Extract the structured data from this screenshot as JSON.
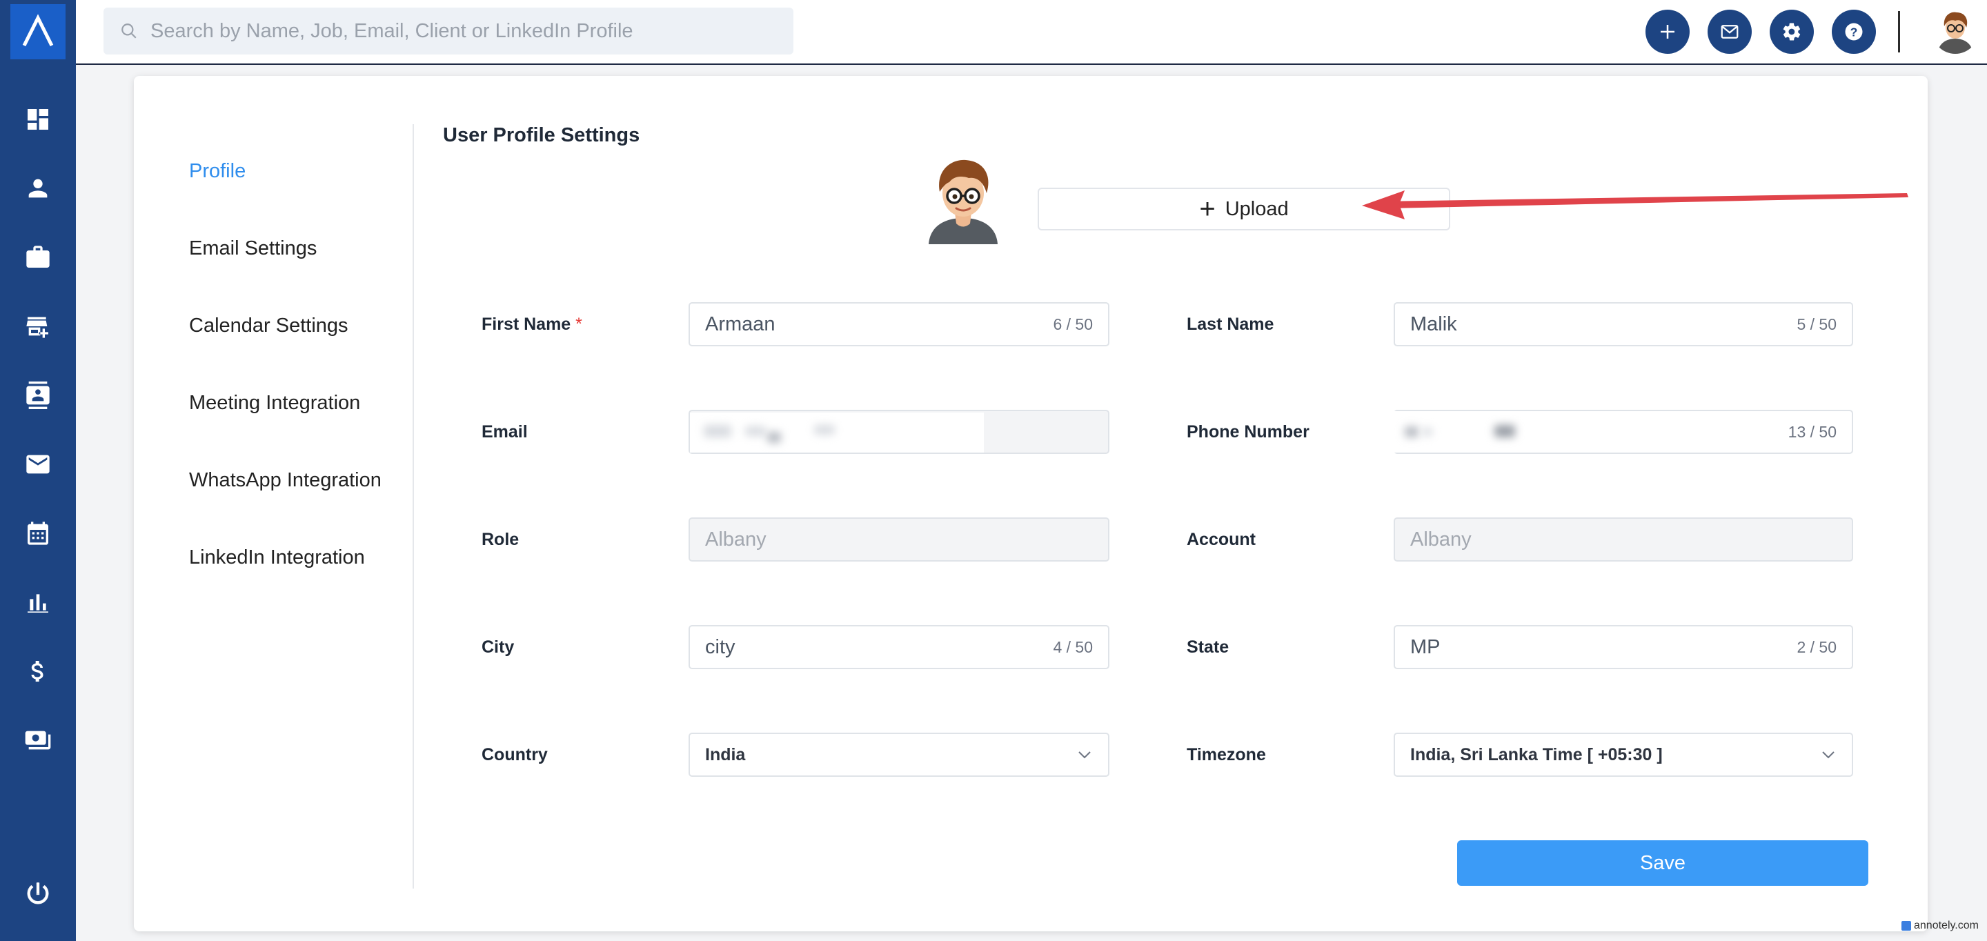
{
  "search": {
    "placeholder": "Search by Name, Job, Email, Client or LinkedIn Profile"
  },
  "colors": {
    "rail": "#1d4482",
    "accent": "#2f8ded",
    "save": "#3b9bf7",
    "arrow": "#e0434a"
  },
  "rail": {
    "icons": [
      "dashboard-icon",
      "person-icon",
      "briefcase-icon",
      "add-store-icon",
      "contact-card-icon",
      "mail-icon",
      "calendar-icon",
      "analytics-icon",
      "dollar-icon",
      "payments-icon",
      "power-icon"
    ]
  },
  "topbar": {
    "buttons": [
      "plus-icon",
      "mail-icon",
      "gear-icon",
      "help-icon"
    ]
  },
  "menu": {
    "items": [
      {
        "label": "Profile",
        "active": true
      },
      {
        "label": "Email Settings"
      },
      {
        "label": "Calendar Settings"
      },
      {
        "label": "Meeting Integration"
      },
      {
        "label": "WhatsApp Integration"
      },
      {
        "label": "LinkedIn Integration"
      }
    ]
  },
  "main": {
    "title": "User Profile Settings",
    "upload_label": "Upload",
    "save_label": "Save"
  },
  "fields": {
    "first_name": {
      "label": "First Name",
      "required_mark": "*",
      "value": "Armaan",
      "count": "6 / 50"
    },
    "last_name": {
      "label": "Last Name",
      "value": "Malik",
      "count": "5 / 50"
    },
    "email": {
      "label": "Email"
    },
    "phone": {
      "label": "Phone Number",
      "count": "13 / 50"
    },
    "role": {
      "label": "Role",
      "value": "Albany"
    },
    "account": {
      "label": "Account",
      "value": "Albany"
    },
    "city": {
      "label": "City",
      "value": "city",
      "count": "4 / 50"
    },
    "state": {
      "label": "State",
      "value": "MP",
      "count": "2 / 50"
    },
    "country": {
      "label": "Country",
      "value": "India"
    },
    "timezone": {
      "label": "Timezone",
      "value": "India, Sri Lanka Time [ +05:30 ]"
    }
  },
  "watermark": "annotely.com"
}
